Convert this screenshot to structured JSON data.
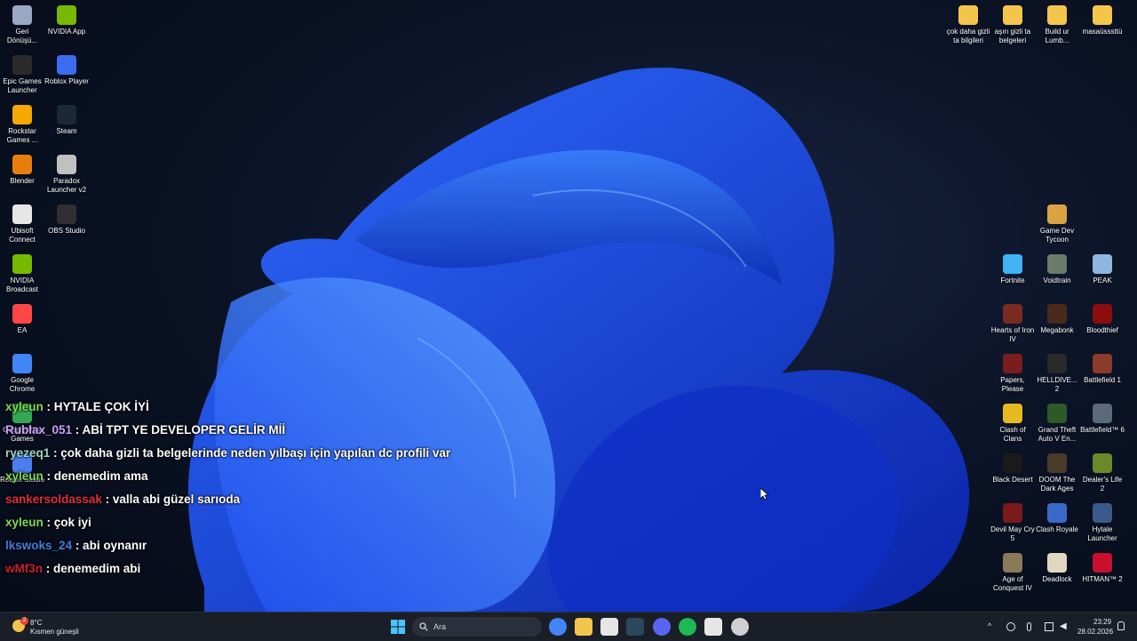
{
  "desktop_left": [
    {
      "label": "Geri Dönüşü...",
      "icon": "recycle-bin-icon",
      "color": "#9aa8c4"
    },
    {
      "label": "NVIDIA App",
      "icon": "nvidia-icon",
      "color": "#76b900"
    },
    {
      "label": "Epic Games Launcher",
      "icon": "epic-games-icon",
      "color": "#2b2b2b"
    },
    {
      "label": "Roblox Player",
      "icon": "roblox-icon",
      "color": "#3a6df0"
    },
    {
      "label": "Rockstar Games ...",
      "icon": "rockstar-icon",
      "color": "#f4a800"
    },
    {
      "label": "Steam",
      "icon": "steam-icon",
      "color": "#1b2838"
    },
    {
      "label": "Blender",
      "icon": "blender-icon",
      "color": "#e87d0d"
    },
    {
      "label": "Paradox Launcher v2",
      "icon": "paradox-icon",
      "color": "#c0c0c0"
    },
    {
      "label": "Ubisoft Connect",
      "icon": "ubisoft-icon",
      "color": "#e6e6e6"
    },
    {
      "label": "OBS Studio",
      "icon": "obs-icon",
      "color": "#302e31"
    },
    {
      "label": "NVIDIA Broadcast",
      "icon": "nvidia-broadcast-icon",
      "color": "#76b900"
    },
    {
      "label": "EA",
      "icon": "ea-icon",
      "color": "#ff4747"
    },
    {
      "label": "Google Chrome",
      "icon": "chrome-icon",
      "color": "#4285f4"
    },
    {
      "label": "Google Play Games",
      "icon": "google-play-games-icon",
      "color": "#34a853"
    },
    {
      "label": "Roblox Studio",
      "icon": "roblox-studio-icon",
      "color": "#4a7df0"
    }
  ],
  "desktop_top_right": [
    {
      "label": "çok daha gizli ta bilgileri",
      "icon": "folder-icon",
      "color": "#f3c54a"
    },
    {
      "label": "aşırı gizli ta belgeleri",
      "icon": "folder-icon",
      "color": "#f3c54a"
    },
    {
      "label": "Build ur Lumb...",
      "icon": "folder-icon",
      "color": "#f3c54a"
    },
    {
      "label": "masaüsssttü",
      "icon": "folder-icon",
      "color": "#f3c54a"
    }
  ],
  "desktop_right": [
    {
      "label": "Game Dev Tycoon",
      "icon": "game-dev-tycoon-icon",
      "color": "#d9a441"
    },
    {
      "label": "Fortnite",
      "icon": "fortnite-icon",
      "color": "#3fb3f5"
    },
    {
      "label": "Voidtrain",
      "icon": "voidtrain-icon",
      "color": "#6b7b6a"
    },
    {
      "label": "PEAK",
      "icon": "peak-icon",
      "color": "#8fb6e0"
    },
    {
      "label": "Hearts of Iron IV",
      "icon": "hoi4-icon",
      "color": "#7a2a1f"
    },
    {
      "label": "Megabonk",
      "icon": "megabonk-icon",
      "color": "#4a2a1a"
    },
    {
      "label": "Bloodthief",
      "icon": "bloodthief-icon",
      "color": "#8b0d0d"
    },
    {
      "label": "Papers, Please",
      "icon": "papers-please-icon",
      "color": "#7a1d1d"
    },
    {
      "label": "HELLDIVE... 2",
      "icon": "helldivers-icon",
      "color": "#2a2a2a"
    },
    {
      "label": "Battlefield 1",
      "icon": "battlefield1-icon",
      "color": "#8c3a2a"
    },
    {
      "label": "Clash of Clans",
      "icon": "clash-of-clans-icon",
      "color": "#e8b820"
    },
    {
      "label": "Grand Theft Auto V En...",
      "icon": "gta5-icon",
      "color": "#2d5a27"
    },
    {
      "label": "Battlefield™ 6",
      "icon": "battlefield6-icon",
      "color": "#5a6a78"
    },
    {
      "label": "Black Desert",
      "icon": "black-desert-icon",
      "color": "#1a1a1a"
    },
    {
      "label": "DOOM The Dark Ages",
      "icon": "doom-icon",
      "color": "#4a3a2a"
    },
    {
      "label": "Dealer's Life 2",
      "icon": "dealers-life-icon",
      "color": "#6a8a2a"
    },
    {
      "label": "Devil May Cry 5",
      "icon": "dmc5-icon",
      "color": "#7a1a1a"
    },
    {
      "label": "Clash Royale",
      "icon": "clash-royale-icon",
      "color": "#3a6ac8"
    },
    {
      "label": "Hytale Launcher",
      "icon": "hytale-icon",
      "color": "#3a5a8a"
    },
    {
      "label": "Age of Conquest IV",
      "icon": "age-of-conquest-icon",
      "color": "#8a7a5a"
    },
    {
      "label": "Deadlock",
      "icon": "deadlock-icon",
      "color": "#e0d8c0"
    },
    {
      "label": "HITMAN™ 2",
      "icon": "hitman2-icon",
      "color": "#c8102e"
    }
  ],
  "chat": [
    {
      "user": "xyleun",
      "color": "#7ed957",
      "msg": " : HYTALE ÇOK İYİ"
    },
    {
      "user": "Rublax_051",
      "color": "#c8a2ff",
      "msg": " : ABİ TPT YE DEVELOPER GELİR Mİİ"
    },
    {
      "user": "ryezeq1",
      "color": "#9ad6c8",
      "msg": " : çok daha gizli ta belgelerinde neden yılbaşı için yapılan dc profili var"
    },
    {
      "user": "xyleun",
      "color": "#7ed957",
      "msg": " : denemedim ama"
    },
    {
      "user": "sankersoldassak",
      "color": "#e0303a",
      "msg": " : valla abi güzel sarıoda"
    },
    {
      "user": "xyleun",
      "color": "#7ed957",
      "msg": " : çok iyi"
    },
    {
      "user": "lkswoks_24",
      "color": "#3f7fe0",
      "msg": " : abi oynanır"
    },
    {
      "user": "wMf3n",
      "color": "#c82030",
      "msg": " : denemedim abi"
    }
  ],
  "taskbar": {
    "search_placeholder": "Ara",
    "weather_temp": "8°C",
    "weather_desc": "Kısmen güneşli",
    "weather_badge": "2",
    "time": "23:29",
    "date": "28.02.2026",
    "pinned": [
      {
        "name": "chrome-icon",
        "color": "#4285f4"
      },
      {
        "name": "file-explorer-icon",
        "color": "#f3c54a"
      },
      {
        "name": "microsoft-store-icon",
        "color": "#e6e6e6"
      },
      {
        "name": "steam-icon",
        "color": "#2a475e"
      },
      {
        "name": "discord-icon",
        "color": "#5865f2"
      },
      {
        "name": "spotify-icon",
        "color": "#1db954"
      },
      {
        "name": "roblox-icon",
        "color": "#e6e6e6"
      },
      {
        "name": "chatgpt-icon",
        "color": "#d0d0d0"
      }
    ]
  }
}
